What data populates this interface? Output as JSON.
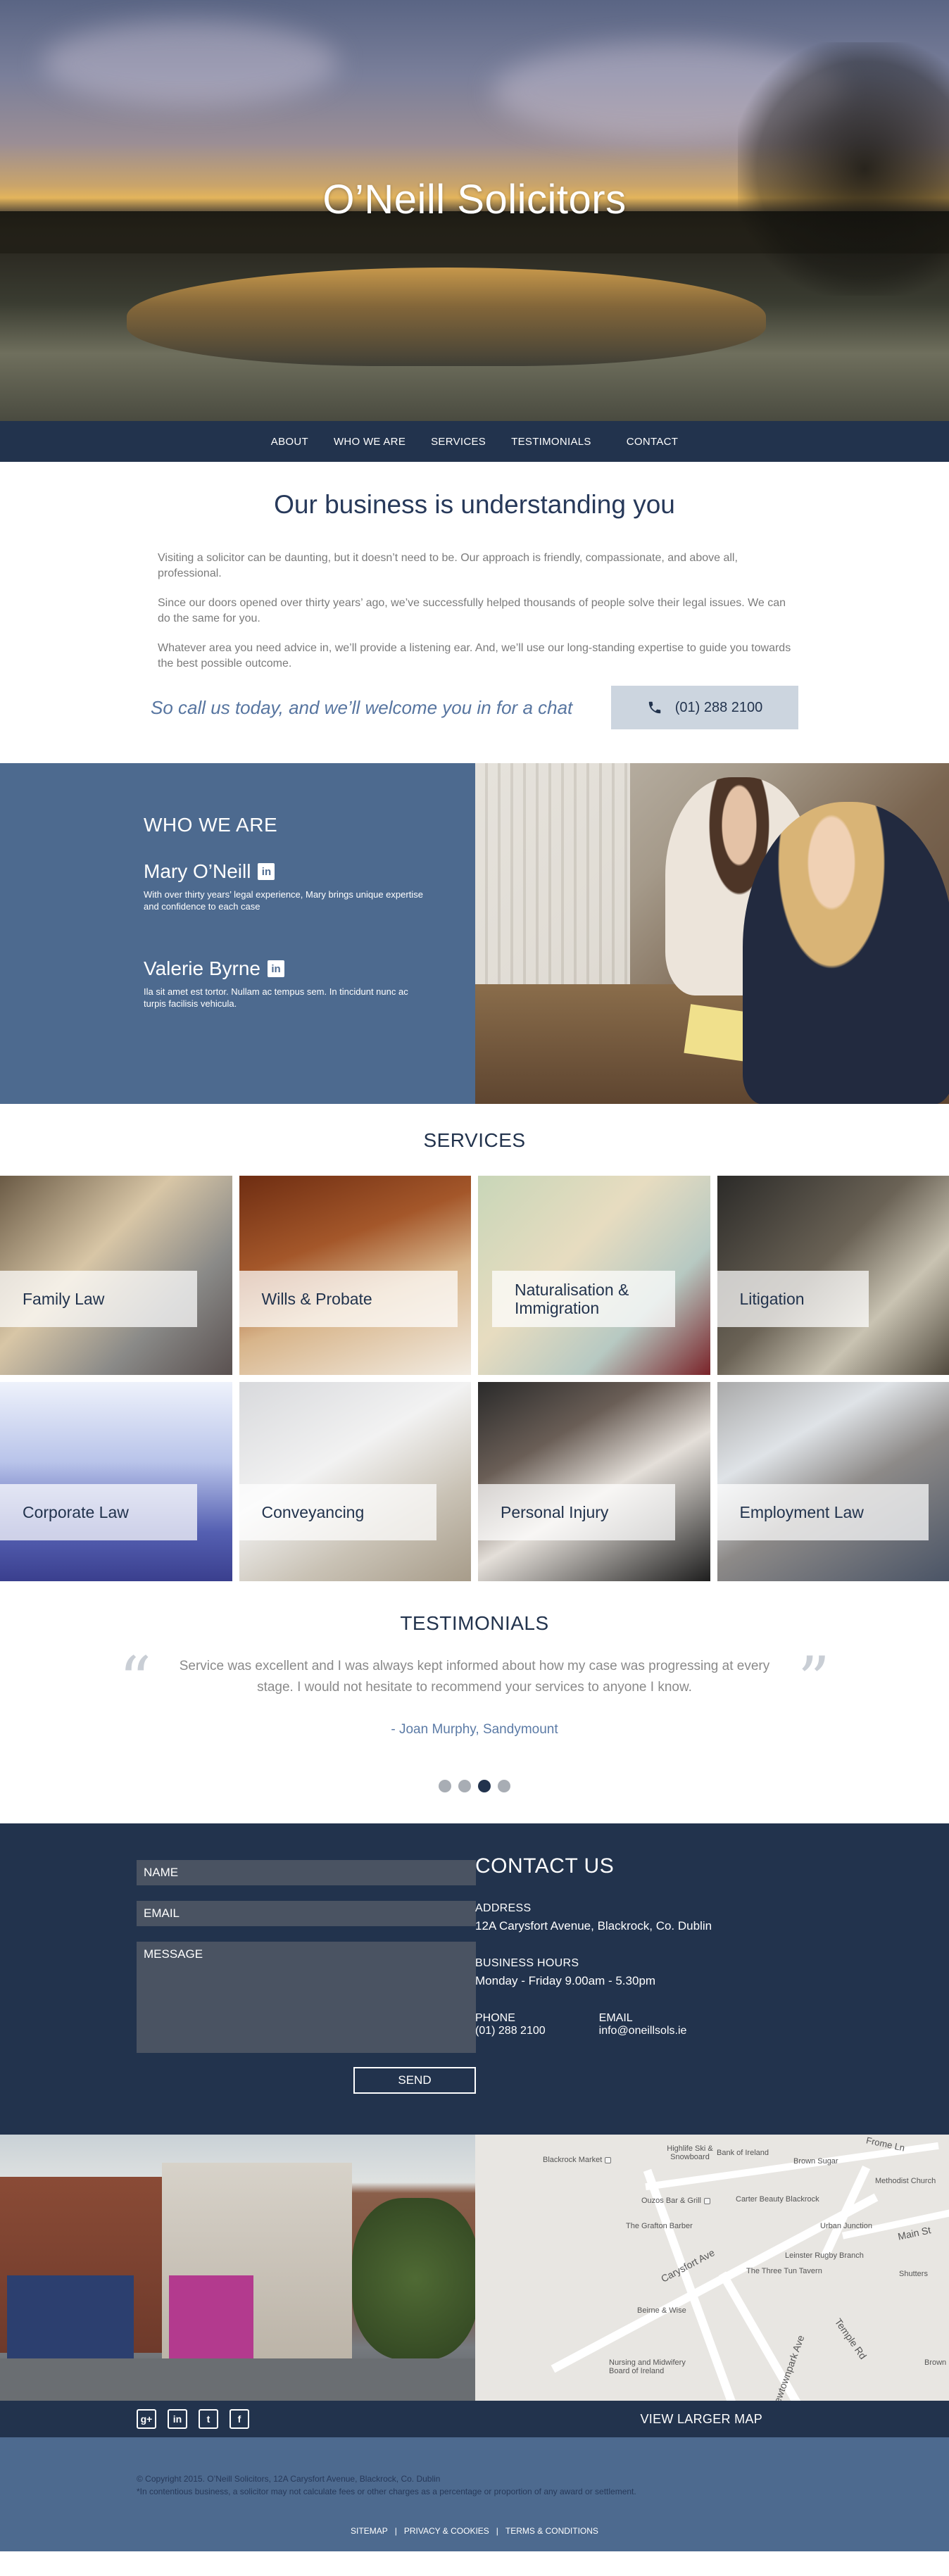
{
  "hero": {
    "title": "O’Neill Solicitors"
  },
  "nav": {
    "items": [
      "ABOUT",
      "WHO WE ARE",
      "SERVICES",
      "TESTIMONIALS",
      "CONTACT"
    ]
  },
  "intro": {
    "heading": "Our business is understanding you",
    "paragraphs": [
      "Visiting a solicitor can be daunting, but it doesn’t need to be. Our approach is friendly, compassionate, and above all, professional.",
      "Since our doors opened over thirty years’ ago, we’ve successfully helped thousands of people solve their legal issues. We can do the same for you.",
      "Whatever area you need advice in, we’ll provide a listening ear. And, we’ll use our long-standing expertise to guide you towards the best possible outcome."
    ],
    "call_tagline": "So call us today, and we’ll welcome you in for a chat",
    "phone": "(01) 288 2100"
  },
  "who": {
    "heading": "WHO WE ARE",
    "people": [
      {
        "name": "Mary O’Neill",
        "bio": "With over thirty years’ legal experience, Mary brings unique expertise and confidence to each case"
      },
      {
        "name": "Valerie Byrne",
        "bio": "Ila sit amet est tortor. Nullam ac tempus sem. In tincidunt nunc ac turpis facilisis vehicula."
      }
    ],
    "linkedin_label": "in"
  },
  "services": {
    "heading": "SERVICES",
    "items": [
      "Family Law",
      "Wills & Probate",
      "Naturalisation & Immigration",
      "Litigation",
      "Corporate Law",
      "Conveyancing",
      "Personal Injury",
      "Employment Law"
    ]
  },
  "testimonials": {
    "heading": "TESTIMONIALS",
    "quote": "Service was excellent and I was always kept informed about how my case was progressing at every stage. I would not hesitate to recommend your services to anyone I know.",
    "author": "- Joan Murphy, Sandymount",
    "open_mark": "“",
    "close_mark": "”",
    "slides": 4,
    "active_slide": 3
  },
  "contact": {
    "form": {
      "name": "NAME",
      "email": "EMAIL",
      "message": "MESSAGE",
      "send": "SEND"
    },
    "heading": "CONTACT US",
    "address_label": "ADDRESS",
    "address": "12A Carysfort Avenue, Blackrock, Co. Dublin",
    "hours_label": "BUSINESS HOURS",
    "hours": "Monday - Friday 9.00am - 5.30pm",
    "phone_label": "PHONE",
    "phone": "(01) 288 2100",
    "email_label": "EMAIL",
    "email": "info@oneillsols.ie"
  },
  "map": {
    "labels": [
      "Blackrock Market",
      "Highlife Ski & Snowboard",
      "Bank of Ireland",
      "Brown Sugar",
      "Methodist Church",
      "Ouzos Bar & Grill",
      "Carter Beauty Blackrock",
      "The Grafton Barber",
      "Urban Junction",
      "Leinster Rugby Branch",
      "The Three Tun Tavern",
      "Shutters",
      "Beirne & Wise",
      "Nursing and Midwifery Board of Ireland",
      "Carysfort Ave",
      "Main St",
      "Temple Rd",
      "Frome Ln",
      "Newtownpark Ave",
      "Brown Beauty"
    ]
  },
  "social": {
    "icons": [
      "google-plus-icon",
      "linkedin-icon",
      "twitter-icon",
      "facebook-icon"
    ],
    "glyphs": [
      "g+",
      "in",
      "t",
      "f"
    ],
    "view_map": "VIEW LARGER MAP"
  },
  "footer": {
    "copyright": "© Copyright 2015. O’Neill Solicitors, 12A Carysfort Avenue, Blackrock, Co. Dublin",
    "disclaimer": "*In contentious business, a solicitor may not calculate fees or other charges as a percentage or proportion of any award or settlement.",
    "links": [
      "SITEMAP",
      "PRIVACY & COOKIES",
      "TERMS & CONDITIONS"
    ],
    "separator": "|"
  }
}
